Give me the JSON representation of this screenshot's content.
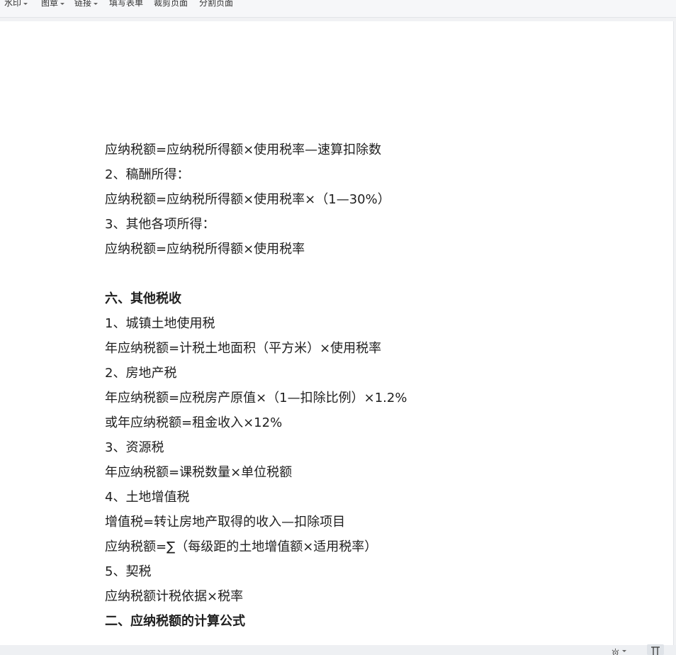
{
  "toolbar": {
    "items": [
      {
        "label": "水印",
        "dropdown": true
      },
      {
        "label": "图章",
        "dropdown": true
      },
      {
        "label": "链接",
        "dropdown": true
      },
      {
        "label": "填写表单",
        "dropdown": false
      },
      {
        "label": "裁剪页面",
        "dropdown": false
      },
      {
        "label": "分割页面",
        "dropdown": false
      }
    ]
  },
  "document": {
    "lines": [
      "应纳税额=应纳税所得额×使用税率—速算扣除数",
      "2、稿酬所得：",
      "应纳税额=应纳税所得额×使用税率×（1—30%）",
      "3、其他各项所得：",
      "应纳税额=应纳税所得额×使用税率",
      "",
      "六、其他税收",
      "1、城镇土地使用税",
      "年应纳税额=计税土地面积（平方米）×使用税率",
      "2、房地产税",
      "年应纳税额=应税房产原值×（1—扣除比例）×1.2%",
      "或年应纳税额=租金收入×12%",
      "3、资源税",
      "年应纳税额=课税数量×单位税额",
      "4、土地增值税",
      "增值税=转让房地产取得的收入—扣除项目",
      "应纳税额=∑（每级距的土地增值额×适用税率）",
      "5、契税",
      "应纳税额计税依据×税率",
      "二、应纳税额的计算公式"
    ]
  },
  "statusbar": {
    "icons": [
      "settings-icon",
      "page-view-icon"
    ]
  },
  "colors": {
    "background": "#f1f2f4",
    "page": "#ffffff",
    "text": "#1f1f1f"
  }
}
